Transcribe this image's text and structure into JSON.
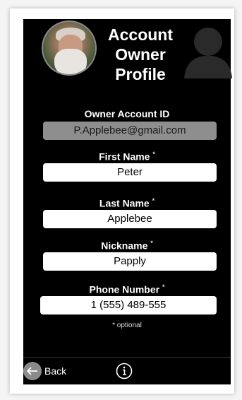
{
  "header": {
    "title_line1": "Account",
    "title_line2": "Owner",
    "title_line3": "Profile"
  },
  "fields": {
    "account_id": {
      "label": "Owner Account ID",
      "value": "P.Applebee@gmail.com"
    },
    "first_name": {
      "label": "First Name",
      "required_mark": "*",
      "value": "Peter"
    },
    "last_name": {
      "label": "Last Name",
      "required_mark": "*",
      "value": "Applebee"
    },
    "nickname": {
      "label": "Nickname",
      "required_mark": "*",
      "value": "Papply"
    },
    "phone": {
      "label": "Phone Number",
      "required_mark": "*",
      "value": "1 (555) 489-555"
    }
  },
  "note": "* optional",
  "bottombar": {
    "back_label": "Back",
    "back_icon": "left-arrow-icon",
    "info_icon": "info-icon"
  }
}
